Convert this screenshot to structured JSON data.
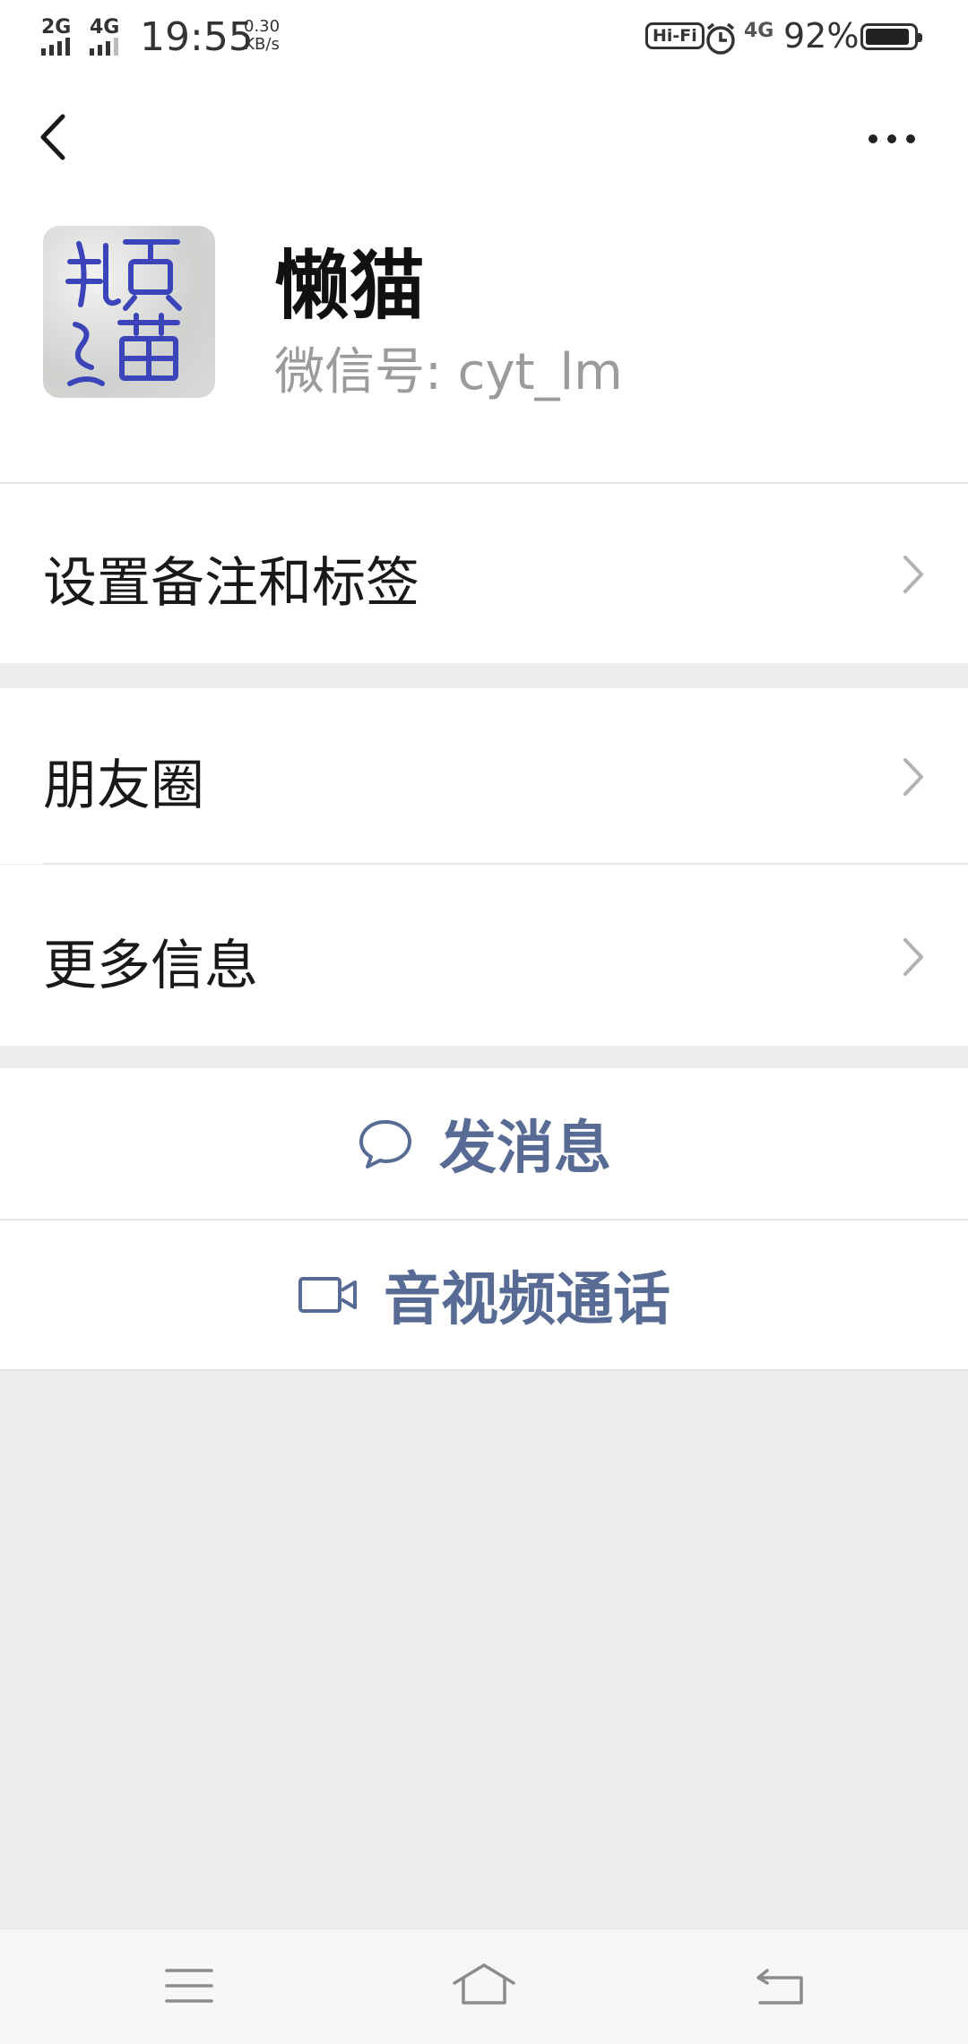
{
  "status_bar": {
    "sim1": "2G",
    "sim2": "4G",
    "time": "19:55",
    "speed_value": "0.30",
    "speed_unit": "KB/s",
    "hifi": "Hi-Fi",
    "net_badge": "4G",
    "battery_percent": "92%",
    "battery_level": 0.92
  },
  "header": {
    "back_icon": "chevron-left-icon",
    "more_icon": "more-horizontal-icon"
  },
  "profile": {
    "nickname": "懒猫",
    "wechat_id": "微信号: cyt_lm",
    "avatar_text": "懶貓"
  },
  "rows": {
    "remark": "设置备注和标签",
    "moments": "朋友圈",
    "more_info": "更多信息"
  },
  "actions": {
    "message": "发消息",
    "call": "音视频通话"
  },
  "colors": {
    "link": "#576b95",
    "background": "#ededed"
  }
}
